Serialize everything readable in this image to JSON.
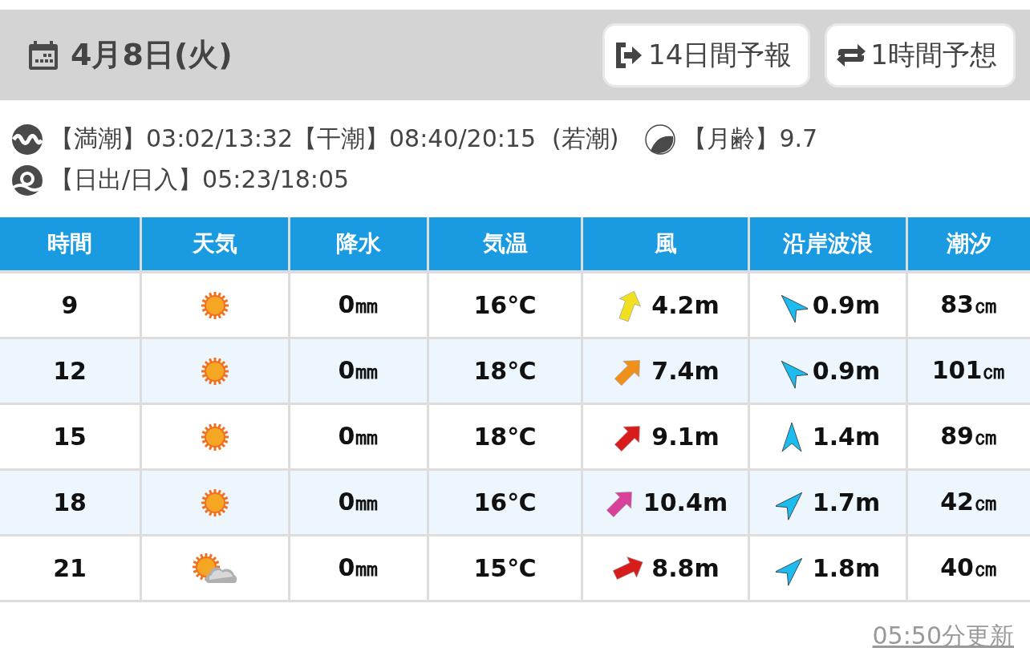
{
  "header": {
    "date": "4月8日(火)",
    "buttons": [
      {
        "kind": "exit",
        "label": "14日間予報"
      },
      {
        "kind": "swap",
        "label": "1時間予想"
      }
    ]
  },
  "info": {
    "tide": "【満潮】03:02/13:32【干潮】08:40/20:15",
    "tide_type": "(若潮)",
    "moon": "【月齢】9.7",
    "sun": "【日出/日入】05:23/18:05"
  },
  "table": {
    "columns": [
      "時間",
      "天気",
      "降水",
      "気温",
      "風",
      "沿岸波浪",
      "潮汐"
    ],
    "rows": [
      {
        "time": "9",
        "weather": {
          "kind": "sunny"
        },
        "rain": "0㎜",
        "temp": "16℃",
        "wind": {
          "kind": "north-northeast",
          "color": "#f0e020",
          "speed": "4.2m"
        },
        "wave": {
          "kind": "northwest",
          "height": "0.9m"
        },
        "tide": "83㎝"
      },
      {
        "time": "12",
        "weather": {
          "kind": "sunny"
        },
        "rain": "0㎜",
        "temp": "18℃",
        "wind": {
          "kind": "northeast",
          "color": "#f0901a",
          "speed": "7.4m"
        },
        "wave": {
          "kind": "northwest",
          "height": "0.9m"
        },
        "tide": "101㎝"
      },
      {
        "time": "15",
        "weather": {
          "kind": "sunny"
        },
        "rain": "0㎜",
        "temp": "18℃",
        "wind": {
          "kind": "northeast",
          "color": "#d81c1c",
          "speed": "9.1m"
        },
        "wave": {
          "kind": "north",
          "height": "1.4m"
        },
        "tide": "89㎝"
      },
      {
        "time": "18",
        "weather": {
          "kind": "sunny"
        },
        "rain": "0㎜",
        "temp": "16℃",
        "wind": {
          "kind": "northeast",
          "color": "#d8409a",
          "speed": "10.4m"
        },
        "wave": {
          "kind": "northeast",
          "height": "1.7m"
        },
        "tide": "42㎝"
      },
      {
        "time": "21",
        "weather": {
          "kind": "sunny-cloudy"
        },
        "rain": "0㎜",
        "temp": "15℃",
        "wind": {
          "kind": "east-northeast",
          "color": "#d81c1c",
          "speed": "8.8m"
        },
        "wave": {
          "kind": "northeast",
          "height": "1.8m"
        },
        "tide": "40㎝"
      }
    ]
  },
  "footer": {
    "updated": "05:50分更新"
  }
}
